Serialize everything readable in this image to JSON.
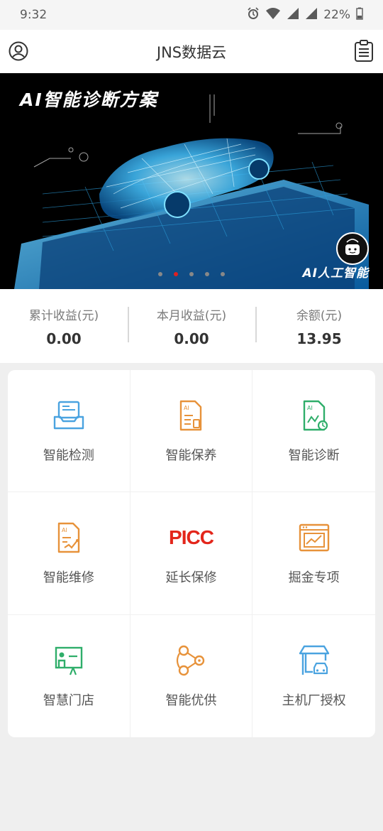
{
  "status_bar": {
    "time": "9:32",
    "battery": "22%"
  },
  "app_bar": {
    "title": "JNS数据云"
  },
  "banner": {
    "title": "AI智能诊断方案",
    "subtitle": "AI人工智能",
    "slides": 5,
    "active_slide": 2
  },
  "stats": [
    {
      "label": "累计收益(元)",
      "value": "0.00"
    },
    {
      "label": "本月收益(元)",
      "value": "0.00"
    },
    {
      "label": "余额(元)",
      "value": "13.95"
    }
  ],
  "menu": [
    {
      "label": "智能检测",
      "icon": "inbox-tray-icon",
      "color": "#4aa3e0"
    },
    {
      "label": "智能保养",
      "icon": "ai-document-icon",
      "color": "#e7923a"
    },
    {
      "label": "智能诊断",
      "icon": "ai-doc-bike-icon",
      "color": "#2fae6a"
    },
    {
      "label": "智能维修",
      "icon": "ai-doc-pen-icon",
      "color": "#e7923a"
    },
    {
      "label": "延长保修",
      "icon": "picc-logo",
      "logo_text": "PICC",
      "color": "#e3261b"
    },
    {
      "label": "掘金专项",
      "icon": "chart-window-icon",
      "color": "#e7923a"
    },
    {
      "label": "智慧门店",
      "icon": "presenter-board-icon",
      "color": "#2fae6a"
    },
    {
      "label": "智能优供",
      "icon": "share-nodes-icon",
      "color": "#e7923a"
    },
    {
      "label": "主机厂授权",
      "icon": "garage-car-icon",
      "color": "#4aa3e0"
    }
  ]
}
